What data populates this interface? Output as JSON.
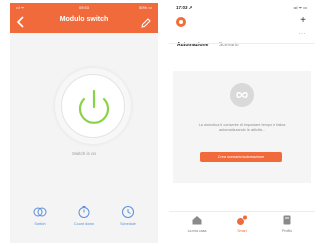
{
  "left_screen": {
    "status_bar": {
      "left": "••l ᯤ",
      "time": "09:53",
      "right": "50% ▭"
    },
    "title": "Modulo switch",
    "switch_state_label": "Switch is on",
    "actions": [
      {
        "label": "Switch",
        "icon": "toggle-icon"
      },
      {
        "label": "Count down",
        "icon": "timer-icon"
      },
      {
        "label": "Schedule",
        "icon": "clock-icon"
      }
    ],
    "colors": {
      "header": "#f06a3c",
      "power_on": "#8bd24a",
      "action": "#5b8fd8"
    }
  },
  "right_screen": {
    "status_bar": {
      "time": "17:03 ➚",
      "right": "••l ᯤ ▭"
    },
    "tabs": [
      {
        "label": "Automazione",
        "active": true
      },
      {
        "label": "Scenario",
        "active": false
      }
    ],
    "more_label": "···",
    "add_label": "+",
    "empty_state": {
      "text": "La domotica ti consente di impostare tempo e fatica automatizzando le attività...",
      "button_label": "Crea scenario/automazione"
    },
    "bottom_nav": [
      {
        "label": "La mia casa",
        "icon": "home-icon",
        "active": false
      },
      {
        "label": "Smart",
        "icon": "smart-icon",
        "active": true
      },
      {
        "label": "Profilo",
        "icon": "profile-icon",
        "active": false
      }
    ],
    "colors": {
      "accent": "#f06a3c"
    }
  }
}
